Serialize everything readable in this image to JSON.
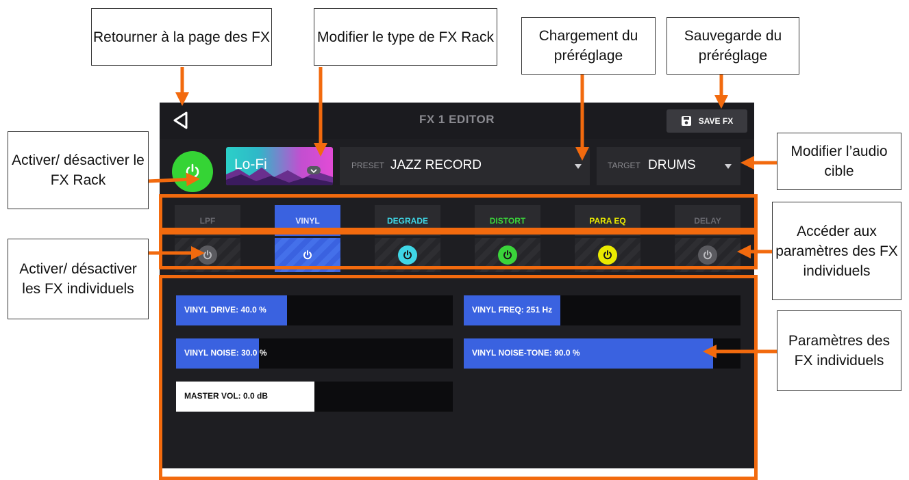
{
  "editor": {
    "title": "FX 1 EDITOR",
    "save_label": "SAVE FX",
    "rack_name": "Lo-Fi",
    "preset_label": "PRESET",
    "preset_value": "JAZZ RECORD",
    "target_label": "TARGET",
    "target_value": "DRUMS",
    "fx": [
      {
        "name": "LPF",
        "color": "#6a6a70",
        "on": false
      },
      {
        "name": "VINYL",
        "color": "#8fa3ff",
        "on": true
      },
      {
        "name": "DEGRADE",
        "color": "#3fd7e6",
        "on": true
      },
      {
        "name": "DISTORT",
        "color": "#3ad43a",
        "on": true
      },
      {
        "name": "PARA EQ",
        "color": "#eaea00",
        "on": true
      },
      {
        "name": "DELAY",
        "color": "#6a6a70",
        "on": false
      }
    ],
    "params": [
      {
        "label": "VINYL DRIVE: 40.0 %",
        "fraction": 0.4,
        "color": "#3a62e0"
      },
      {
        "label": "VINYL FREQ: 251 Hz",
        "fraction": 0.35,
        "color": "#3a62e0"
      },
      {
        "label": "VINYL NOISE: 30.0 %",
        "fraction": 0.3,
        "color": "#3a62e0"
      },
      {
        "label": "VINYL NOISE-TONE: 90.0 %",
        "fraction": 0.9,
        "color": "#3a62e0"
      },
      {
        "label": "MASTER VOL: 0.0 dB",
        "fraction": 0.5,
        "color": "#ffffff"
      }
    ]
  },
  "callouts": {
    "back": "Retourner à la page des FX",
    "rack_type": "Modifier le type de FX Rack",
    "preset_load": "Chargement du préréglage",
    "preset_save": "Sauvegarde du préréglage",
    "rack_power": "Activer/ désactiver le FX Rack",
    "target": "Modifier l’audio cible",
    "fx_access": "Accéder aux paramètres des FX individuels",
    "fx_power": "Activer/ désactiver les FX individuels",
    "fx_params": "Paramètres des FX individuels"
  },
  "colors": {
    "accent": "#f26a0e",
    "power_on": "#35d435"
  }
}
